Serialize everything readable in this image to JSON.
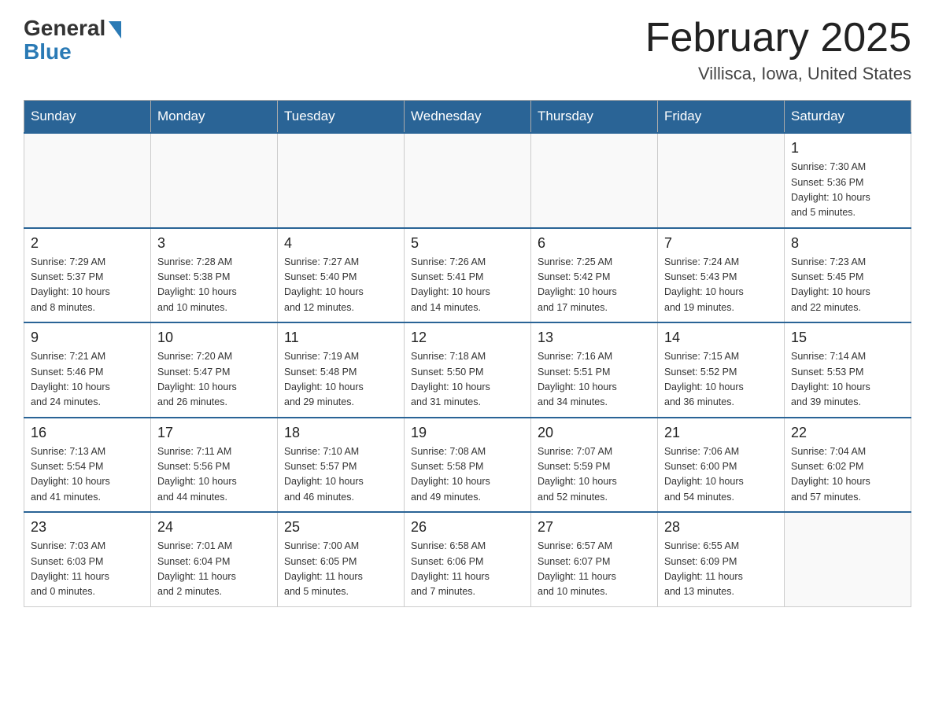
{
  "header": {
    "logo_general": "General",
    "logo_blue": "Blue",
    "month_title": "February 2025",
    "location": "Villisca, Iowa, United States"
  },
  "weekdays": [
    "Sunday",
    "Monday",
    "Tuesday",
    "Wednesday",
    "Thursday",
    "Friday",
    "Saturday"
  ],
  "weeks": [
    [
      {
        "day": "",
        "info": ""
      },
      {
        "day": "",
        "info": ""
      },
      {
        "day": "",
        "info": ""
      },
      {
        "day": "",
        "info": ""
      },
      {
        "day": "",
        "info": ""
      },
      {
        "day": "",
        "info": ""
      },
      {
        "day": "1",
        "info": "Sunrise: 7:30 AM\nSunset: 5:36 PM\nDaylight: 10 hours\nand 5 minutes."
      }
    ],
    [
      {
        "day": "2",
        "info": "Sunrise: 7:29 AM\nSunset: 5:37 PM\nDaylight: 10 hours\nand 8 minutes."
      },
      {
        "day": "3",
        "info": "Sunrise: 7:28 AM\nSunset: 5:38 PM\nDaylight: 10 hours\nand 10 minutes."
      },
      {
        "day": "4",
        "info": "Sunrise: 7:27 AM\nSunset: 5:40 PM\nDaylight: 10 hours\nand 12 minutes."
      },
      {
        "day": "5",
        "info": "Sunrise: 7:26 AM\nSunset: 5:41 PM\nDaylight: 10 hours\nand 14 minutes."
      },
      {
        "day": "6",
        "info": "Sunrise: 7:25 AM\nSunset: 5:42 PM\nDaylight: 10 hours\nand 17 minutes."
      },
      {
        "day": "7",
        "info": "Sunrise: 7:24 AM\nSunset: 5:43 PM\nDaylight: 10 hours\nand 19 minutes."
      },
      {
        "day": "8",
        "info": "Sunrise: 7:23 AM\nSunset: 5:45 PM\nDaylight: 10 hours\nand 22 minutes."
      }
    ],
    [
      {
        "day": "9",
        "info": "Sunrise: 7:21 AM\nSunset: 5:46 PM\nDaylight: 10 hours\nand 24 minutes."
      },
      {
        "day": "10",
        "info": "Sunrise: 7:20 AM\nSunset: 5:47 PM\nDaylight: 10 hours\nand 26 minutes."
      },
      {
        "day": "11",
        "info": "Sunrise: 7:19 AM\nSunset: 5:48 PM\nDaylight: 10 hours\nand 29 minutes."
      },
      {
        "day": "12",
        "info": "Sunrise: 7:18 AM\nSunset: 5:50 PM\nDaylight: 10 hours\nand 31 minutes."
      },
      {
        "day": "13",
        "info": "Sunrise: 7:16 AM\nSunset: 5:51 PM\nDaylight: 10 hours\nand 34 minutes."
      },
      {
        "day": "14",
        "info": "Sunrise: 7:15 AM\nSunset: 5:52 PM\nDaylight: 10 hours\nand 36 minutes."
      },
      {
        "day": "15",
        "info": "Sunrise: 7:14 AM\nSunset: 5:53 PM\nDaylight: 10 hours\nand 39 minutes."
      }
    ],
    [
      {
        "day": "16",
        "info": "Sunrise: 7:13 AM\nSunset: 5:54 PM\nDaylight: 10 hours\nand 41 minutes."
      },
      {
        "day": "17",
        "info": "Sunrise: 7:11 AM\nSunset: 5:56 PM\nDaylight: 10 hours\nand 44 minutes."
      },
      {
        "day": "18",
        "info": "Sunrise: 7:10 AM\nSunset: 5:57 PM\nDaylight: 10 hours\nand 46 minutes."
      },
      {
        "day": "19",
        "info": "Sunrise: 7:08 AM\nSunset: 5:58 PM\nDaylight: 10 hours\nand 49 minutes."
      },
      {
        "day": "20",
        "info": "Sunrise: 7:07 AM\nSunset: 5:59 PM\nDaylight: 10 hours\nand 52 minutes."
      },
      {
        "day": "21",
        "info": "Sunrise: 7:06 AM\nSunset: 6:00 PM\nDaylight: 10 hours\nand 54 minutes."
      },
      {
        "day": "22",
        "info": "Sunrise: 7:04 AM\nSunset: 6:02 PM\nDaylight: 10 hours\nand 57 minutes."
      }
    ],
    [
      {
        "day": "23",
        "info": "Sunrise: 7:03 AM\nSunset: 6:03 PM\nDaylight: 11 hours\nand 0 minutes."
      },
      {
        "day": "24",
        "info": "Sunrise: 7:01 AM\nSunset: 6:04 PM\nDaylight: 11 hours\nand 2 minutes."
      },
      {
        "day": "25",
        "info": "Sunrise: 7:00 AM\nSunset: 6:05 PM\nDaylight: 11 hours\nand 5 minutes."
      },
      {
        "day": "26",
        "info": "Sunrise: 6:58 AM\nSunset: 6:06 PM\nDaylight: 11 hours\nand 7 minutes."
      },
      {
        "day": "27",
        "info": "Sunrise: 6:57 AM\nSunset: 6:07 PM\nDaylight: 11 hours\nand 10 minutes."
      },
      {
        "day": "28",
        "info": "Sunrise: 6:55 AM\nSunset: 6:09 PM\nDaylight: 11 hours\nand 13 minutes."
      },
      {
        "day": "",
        "info": ""
      }
    ]
  ]
}
